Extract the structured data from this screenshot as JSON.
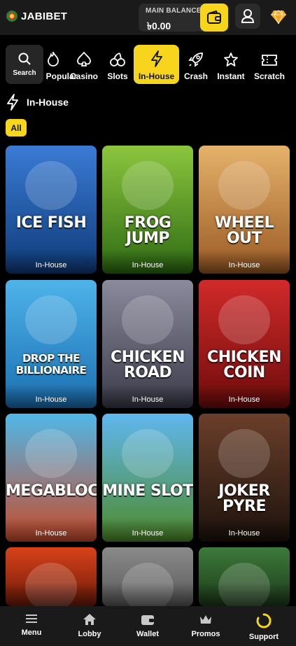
{
  "header": {
    "brand": "JABIBET",
    "balance_label": "MAIN BALANCE",
    "balance_value": "৳0.00"
  },
  "categories": {
    "search_label": "Search",
    "items": [
      {
        "label": "Popular",
        "icon": "fire-icon"
      },
      {
        "label": "Casino",
        "icon": "spade-icon"
      },
      {
        "label": "Slots",
        "icon": "cherry-icon"
      },
      {
        "label": "In-House",
        "icon": "lightning-icon"
      },
      {
        "label": "Crash",
        "icon": "rocket-icon"
      },
      {
        "label": "Instant",
        "icon": "star-icon"
      },
      {
        "label": "Scratch",
        "icon": "ticket-icon"
      }
    ],
    "active": "In-House"
  },
  "section": {
    "title": "In-House",
    "filter_all": "All"
  },
  "games": [
    {
      "title": "ICE FISH",
      "category": "In-House",
      "colors": [
        "#3a7bd5",
        "#0f3b78"
      ]
    },
    {
      "title": "FROG JUMP",
      "category": "In-House",
      "colors": [
        "#8cc63f",
        "#2e6b12"
      ]
    },
    {
      "title": "WHEEL OUT",
      "category": "In-House",
      "colors": [
        "#e5b26b",
        "#9a5a24"
      ]
    },
    {
      "title": "DROP THE BILLIONAIRE",
      "category": "In-House",
      "colors": [
        "#4fb3ea",
        "#1a6fb0"
      ]
    },
    {
      "title": "CHICKEN ROAD",
      "category": "In-House",
      "colors": [
        "#8a8a9c",
        "#3b3b4a"
      ]
    },
    {
      "title": "CHICKEN COIN",
      "category": "In-House",
      "colors": [
        "#d12a2a",
        "#6e0c0c"
      ]
    },
    {
      "title": "MEGABLOCK",
      "category": "In-House",
      "colors": [
        "#4fb8e8",
        "#c94a2a"
      ]
    },
    {
      "title": "MINE SLOT",
      "category": "In-House",
      "colors": [
        "#5fb7ef",
        "#4f8a2a"
      ]
    },
    {
      "title": "JOKER PYRE",
      "category": "In-House",
      "colors": [
        "#6b3f2a",
        "#1c120c"
      ]
    },
    {
      "title": "",
      "category": "",
      "colors": [
        "#d8421a",
        "#6e1a08"
      ]
    },
    {
      "title": "",
      "category": "",
      "colors": [
        "#8a8a8a",
        "#5a5a5a"
      ]
    },
    {
      "title": "",
      "category": "",
      "colors": [
        "#3d7a3a",
        "#1c3b1a"
      ]
    }
  ],
  "bottom_nav": [
    {
      "label": "Menu",
      "icon": "hamburger-icon"
    },
    {
      "label": "Lobby",
      "icon": "home-icon"
    },
    {
      "label": "Wallet",
      "icon": "wallet-icon"
    },
    {
      "label": "Promos",
      "icon": "crown-icon"
    },
    {
      "label": "Support",
      "icon": "spinner-icon"
    }
  ],
  "accent": "#f7d51d"
}
